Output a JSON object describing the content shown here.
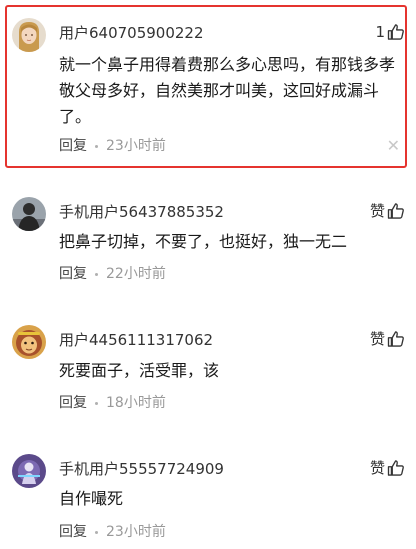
{
  "comments": [
    {
      "username": "用户640705900222",
      "like_count": "1",
      "content": "就一个鼻子用得着费那么多心思吗，有那钱多孝敬父母多好，自然美那才叫美，这回好成漏斗了。",
      "reply_label": "回复",
      "time": "23小时前",
      "highlighted": true,
      "avatar_icon": "girl-avatar-icon"
    },
    {
      "username": "手机用户56437885352",
      "like_label": "赞",
      "content": "把鼻子切掉，不要了，也挺好，独一无二",
      "reply_label": "回复",
      "time": "22小时前",
      "avatar_icon": "dark-figure-avatar-icon"
    },
    {
      "username": "用户4456111317062",
      "like_label": "赞",
      "content": "死要面子，活受罪，该",
      "reply_label": "回复",
      "time": "18小时前",
      "avatar_icon": "monkey-king-avatar-icon"
    },
    {
      "username": "手机用户55557724909",
      "like_label": "赞",
      "content": "自作嘬死",
      "reply_label": "回复",
      "time": "23小时前",
      "avatar_icon": "purple-figure-avatar-icon"
    }
  ],
  "colors": {
    "highlight_border": "#e5342f",
    "time": "#999999",
    "close": "#c8c8c8"
  },
  "icons": {
    "like": "thumbs-up-icon",
    "close": "close-icon"
  }
}
